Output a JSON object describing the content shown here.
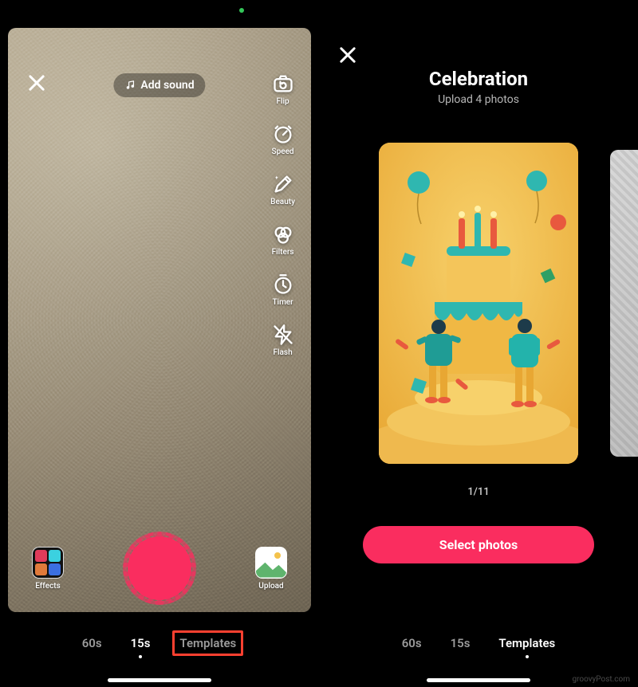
{
  "left": {
    "add_sound_label": "Add sound",
    "tools": [
      {
        "name": "flip",
        "label": "Flip"
      },
      {
        "name": "speed",
        "label": "Speed"
      },
      {
        "name": "beauty",
        "label": "Beauty"
      },
      {
        "name": "filters",
        "label": "Filters"
      },
      {
        "name": "timer",
        "label": "Timer"
      },
      {
        "name": "flash",
        "label": "Flash"
      }
    ],
    "effects_label": "Effects",
    "upload_label": "Upload",
    "tabs": {
      "sixty": "60s",
      "fifteen": "15s",
      "templates": "Templates",
      "active": "15s",
      "highlighted": "Templates"
    }
  },
  "right": {
    "title": "Celebration",
    "subtitle": "Upload 4 photos",
    "counter": "1/11",
    "select_label": "Select photos",
    "tabs": {
      "sixty": "60s",
      "fifteen": "15s",
      "templates": "Templates",
      "active": "Templates"
    }
  },
  "watermark": "groovyPost.com"
}
